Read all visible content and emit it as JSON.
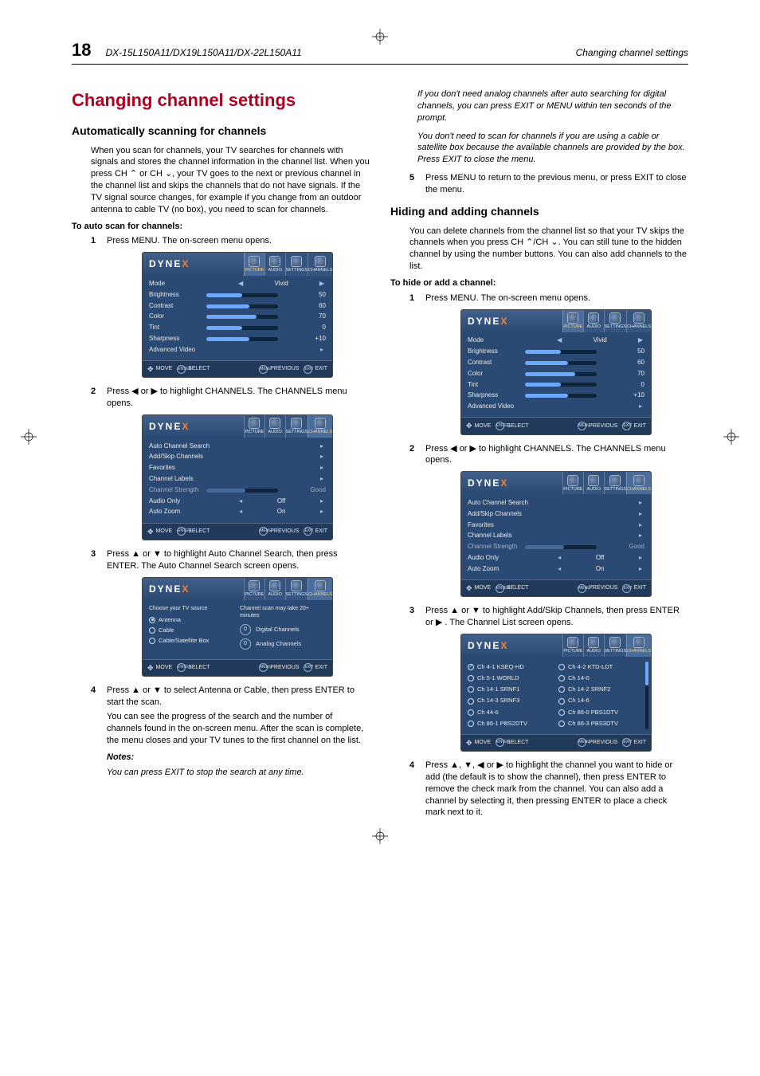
{
  "header": {
    "page_number": "18",
    "models": "DX-15L150A11/DX19L150A11/DX-22L150A11",
    "breadcrumb_right": "Changing channel settings"
  },
  "left": {
    "h1": "Changing channel settings",
    "h2": "Automatically scanning for channels",
    "intro_para": "When you scan for channels, your TV searches for channels with signals and stores the channel information in the channel list. When you press CH ⌃ or CH ⌄, your TV goes to the next or previous channel in the channel list and skips the channels that do not have signals. If the TV signal source changes, for example if you change from an outdoor antenna to cable TV (no box), you need to scan for channels.",
    "lead": "To auto scan for channels:",
    "step1": "Press MENU. The on-screen menu opens.",
    "step2": "Press ◀ or ▶ to highlight CHANNELS. The CHANNELS menu opens.",
    "step3": "Press ▲ or ▼ to highlight Auto Channel Search, then press ENTER. The Auto Channel Search screen opens.",
    "step4": "Press ▲ or ▼ to select Antenna or Cable, then press ENTER to start the scan.",
    "step4_after": "You can see the progress of the search and the number of channels found in the on-screen menu. After the scan is complete, the menu closes and your TV tunes to the first channel on the list.",
    "notes_label": "Notes:",
    "note1": "You can press EXIT to stop the search at any time."
  },
  "right": {
    "note2": "If you don't need analog channels after auto searching for digital channels, you can press EXIT or MENU within ten seconds of the prompt.",
    "note3": "You don't need to scan for channels if you are using a cable or satellite box because the available channels are provided by the box. Press EXIT to close the menu.",
    "step5": "Press MENU to return to the previous menu, or press EXIT to close the menu.",
    "h2": "Hiding and adding channels",
    "intro_para": "You can delete channels from the channel list so that your TV skips the channels when you press CH ⌃/CH ⌄. You can still tune to the hidden channel by using the number buttons. You can also add channels to the list.",
    "lead": "To hide or add a channel:",
    "step1": "Press MENU. The on-screen menu opens.",
    "step2": "Press ◀ or ▶ to highlight CHANNELS. The CHANNELS menu opens.",
    "step3": "Press ▲ or ▼ to highlight Add/Skip Channels, then press ENTER or ▶ . The Channel List screen opens.",
    "step4": "Press ▲, ▼, ◀ or ▶ to highlight the channel you want to hide or add (the default is to show the channel), then press ENTER to remove the check mark from the channel. You can also add a channel by selecting it, then pressing ENTER to place a check mark next to it."
  },
  "osd": {
    "logo": "DYNE",
    "logo_x": "X",
    "tabs": {
      "picture": "PICTURE",
      "audio": "AUDIO",
      "settings": "SETTINGS",
      "channels": "CHANNELS"
    },
    "picture_menu": {
      "mode_label": "Mode",
      "mode_value": "Vivid",
      "brightness_label": "Brightness",
      "brightness_val": "50",
      "contrast_label": "Contrast",
      "contrast_val": "60",
      "color_label": "Color",
      "color_val": "70",
      "tint_label": "Tint",
      "tint_val": "0",
      "sharpness_label": "Sharpness",
      "sharpness_val": "+10",
      "advanced_label": "Advanced Video"
    },
    "channels_menu": {
      "auto_search": "Auto Channel Search",
      "add_skip": "Add/Skip Channels",
      "favorites": "Favorites",
      "labels": "Channel Labels",
      "strength": "Channel Strength",
      "strength_val": "Good",
      "audio_only_label": "Audio Only",
      "audio_only_val": "Off",
      "auto_zoom_label": "Auto Zoom",
      "auto_zoom_val": "On"
    },
    "source_select": {
      "choose_hdr": "Choose your TV source",
      "antenna": "Antenna",
      "cable": "Cable",
      "cablesat": "Cable/Satellite Box",
      "msg": "Channel scan may take 20+ minutes",
      "digital_n": "0",
      "digital_label": "Digital Channels",
      "analog_n": "0",
      "analog_label": "Analog Channels"
    },
    "channel_list": {
      "c0": "Ch 4-1 KSEQ-HD",
      "c1": "Ch 5-1 WORLD",
      "c2": "Ch 14-1 SRNF1",
      "c3": "Ch 14-3 SRNF3",
      "c4": "Ch 44-6",
      "c5": "Ch 86-1 PBS2DTV",
      "r0": "Ch 4-2 KTD-LDT",
      "r1": "Ch 14-0",
      "r2": "Ch 14-2 SRNF2",
      "r3": "Ch 14-6",
      "r4": "Ch 86-0 PBS1DTV",
      "r5": "Ch 86-3 PBS3DTV"
    },
    "foot": {
      "move": "MOVE",
      "select": "SELECT",
      "select_btn": "ENTER",
      "previous": "PREVIOUS",
      "previous_btn": "MENU",
      "exit": "EXIT",
      "exit_btn": "EXIT"
    }
  },
  "chart_data": {
    "type": "table",
    "title": "Picture menu slider values",
    "rows": [
      {
        "setting": "Brightness",
        "value": 50,
        "range": [
          0,
          100
        ]
      },
      {
        "setting": "Contrast",
        "value": 60,
        "range": [
          0,
          100
        ]
      },
      {
        "setting": "Color",
        "value": 70,
        "range": [
          0,
          100
        ]
      },
      {
        "setting": "Tint",
        "value": 0,
        "range": [
          -50,
          50
        ]
      },
      {
        "setting": "Sharpness",
        "value": 10,
        "range": [
          -50,
          50
        ]
      }
    ]
  }
}
